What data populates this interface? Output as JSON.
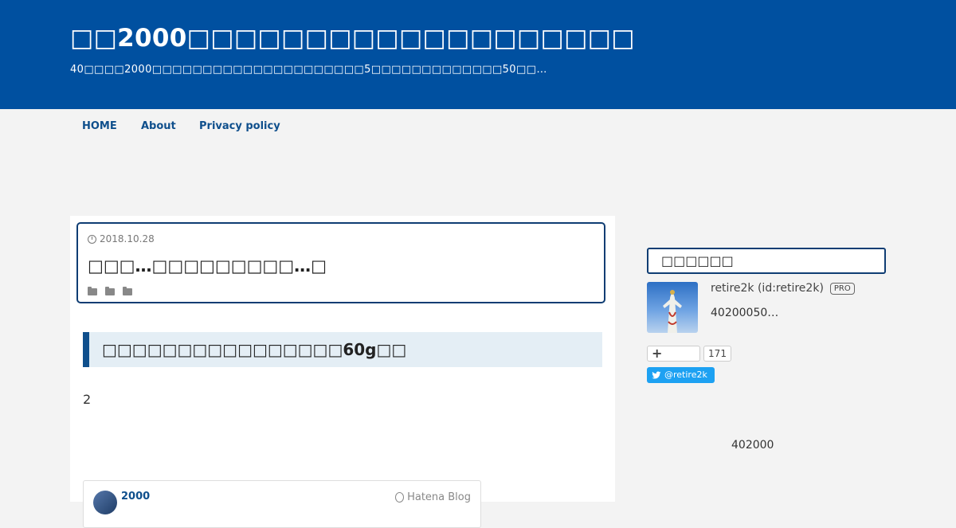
{
  "header": {
    "title": "□□2000□□□□□□□□□□□□□□□□□□□",
    "description": "40□□□□2000□□□□□□□□□□□□□□□□□□□□□5□□□□□□□□□□□□□50□□…"
  },
  "nav": {
    "items": [
      {
        "label": "HOME"
      },
      {
        "label": "About"
      },
      {
        "label": "Privacy policy"
      }
    ]
  },
  "entry": {
    "date": "2018.10.28",
    "title": "□□□…□□□□□□□□□…□",
    "heading": "□□□□□□□□□□□□□□□□60g□□",
    "body": "2",
    "embed": {
      "name": "2000",
      "logo": "Hatena Blog"
    }
  },
  "sidebar": {
    "title": "□□□□□□",
    "profile": {
      "name": "retire2k (id:retire2k)",
      "badge": "PRO",
      "description": "40200050…"
    },
    "subscribe_count": "171",
    "twitter_handle": "@retire2k",
    "bottom_number": "402000"
  },
  "colors": {
    "header_bg": "#0050a0",
    "accent": "#0f4f8c",
    "twitter": "#1da1f2"
  }
}
